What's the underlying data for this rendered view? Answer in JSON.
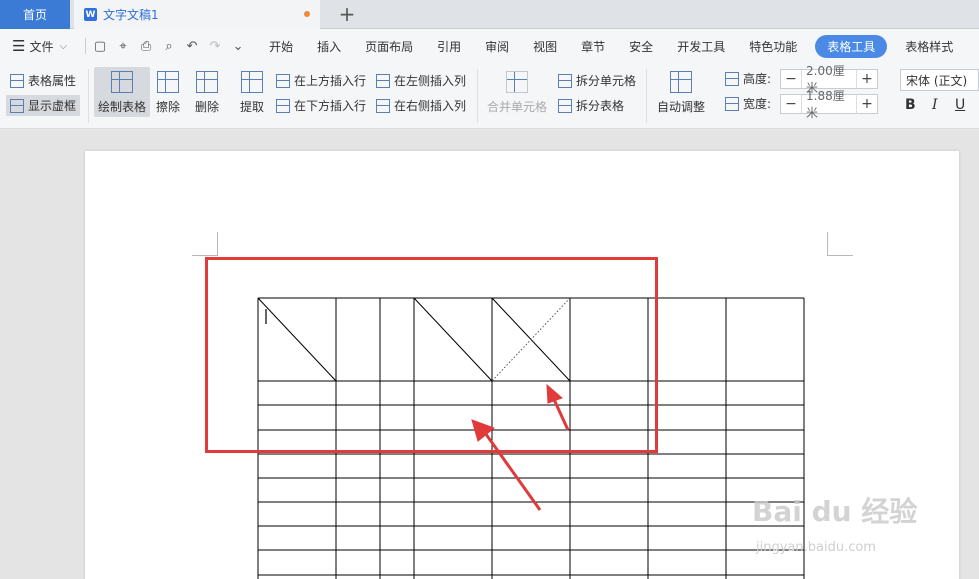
{
  "tabs": {
    "home": "首页",
    "doc": "文字文稿1",
    "add": "+"
  },
  "menu": {
    "file": "文件",
    "items": [
      "开始",
      "插入",
      "页面布局",
      "引用",
      "审阅",
      "视图",
      "章节",
      "安全",
      "开发工具",
      "特色功能",
      "表格工具",
      "表格样式"
    ]
  },
  "ribbon": {
    "table_props": "表格属性",
    "show_grid": "显示虚框",
    "draw_table": "绘制表格",
    "erase": "擦除",
    "delete": "删除",
    "extract": "提取",
    "insert_above": "在上方插入行",
    "insert_below": "在下方插入行",
    "insert_left": "在左侧插入列",
    "insert_right": "在右侧插入列",
    "merge_cells": "合并单元格",
    "split_cells": "拆分单元格",
    "split_table": "拆分表格",
    "auto_fit": "自动调整",
    "height_label": "高度:",
    "height_value": "2.00厘米",
    "width_label": "宽度:",
    "width_value": "1.88厘米",
    "font": "宋体 (正文)",
    "bold": "B",
    "italic": "I",
    "underline": "U"
  },
  "watermark": {
    "main": "Bai du 经验",
    "sub": "jingyan.baidu.com"
  },
  "colors": {
    "accent": "#3b7bd6",
    "highlight": "#e03a3a"
  }
}
